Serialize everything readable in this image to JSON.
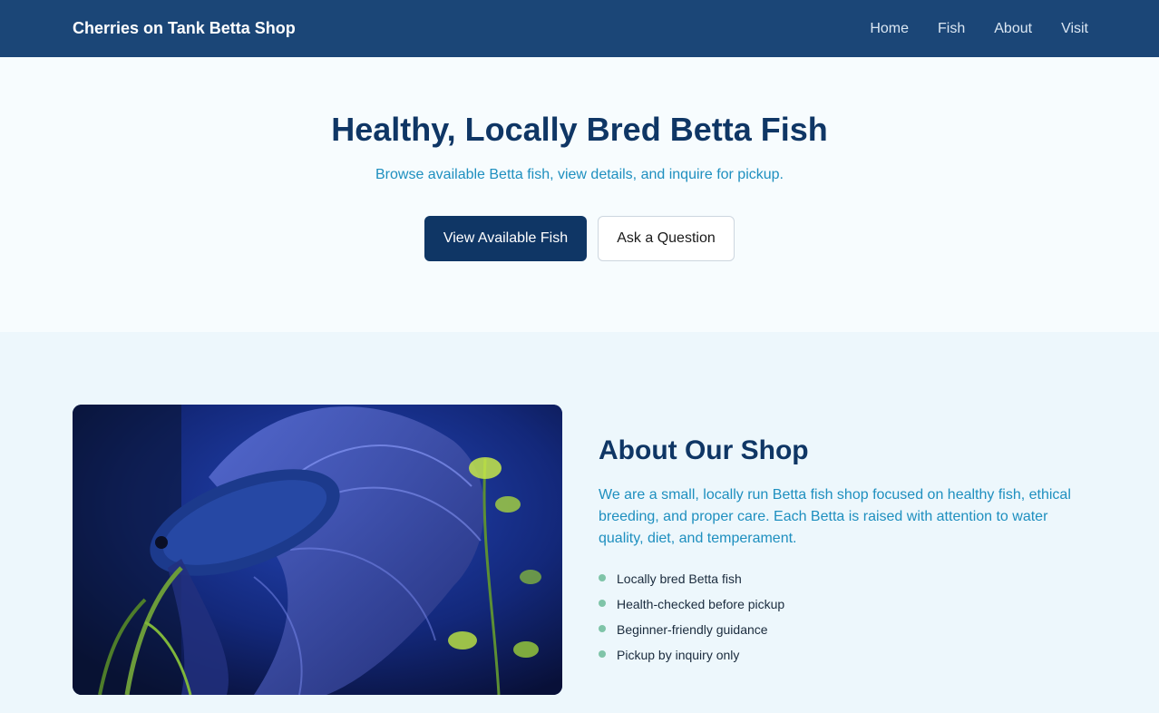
{
  "nav": {
    "brand": "Cherries on Tank Betta Shop",
    "links": [
      "Home",
      "Fish",
      "About",
      "Visit"
    ]
  },
  "hero": {
    "title": "Healthy, Locally Bred Betta Fish",
    "subtitle": "Browse available Betta fish, view details, and inquire for pickup.",
    "primary_button": "View Available Fish",
    "secondary_button": "Ask a Question"
  },
  "about": {
    "image": "betta-fish-photo",
    "title": "About Our Shop",
    "description": "We are a small, locally run Betta fish shop focused on healthy fish, ethical breeding, and proper care. Each Betta is raised with attention to water quality, diet, and temperament.",
    "features": [
      "Locally bred Betta fish",
      "Health-checked before pickup",
      "Beginner-friendly guidance",
      "Pickup by inquiry only"
    ]
  },
  "colors": {
    "navbar": "#1b4677",
    "primary": "#0f3665",
    "accent_text": "#1e8fbf",
    "bullet": "#7fc4a8"
  }
}
